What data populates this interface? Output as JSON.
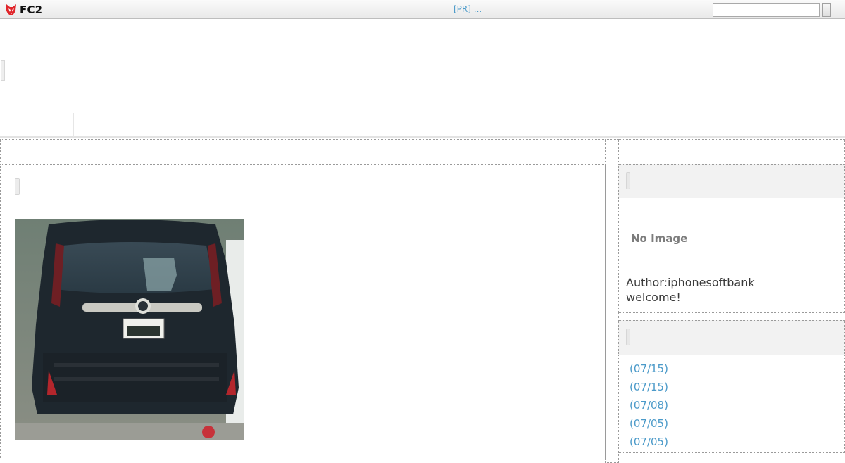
{
  "topbar": {
    "logo_text": "FC2",
    "logo_icon": "fc2-fox-icon",
    "pr_text": "[PR] ...",
    "search": {
      "value": "",
      "placeholder": ""
    }
  },
  "sidebar": {
    "profile": {
      "no_image_text": "No Image",
      "author_text": "Author:iphonesoftbank",
      "welcome_text": "welcome!"
    },
    "recent_entries": [
      {
        "date": "(07/15)"
      },
      {
        "date": "(07/15)"
      },
      {
        "date": "(07/08)"
      },
      {
        "date": "(07/05)"
      },
      {
        "date": "(07/05)"
      }
    ]
  },
  "colors": {
    "link": "#4b9ac9",
    "logo_red": "#e0262b",
    "plugin_header_bg": "#f2f2f2"
  }
}
